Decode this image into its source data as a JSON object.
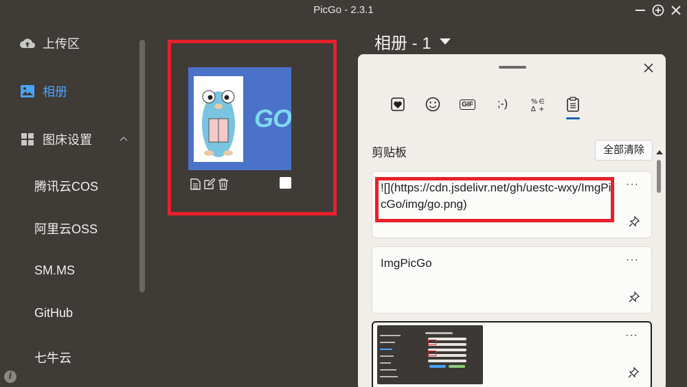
{
  "window": {
    "title": "PicGo - 2.3.1"
  },
  "sidebar": {
    "items": [
      {
        "label": "上传区",
        "icon": "cloud-upload-icon"
      },
      {
        "label": "相册",
        "icon": "image-icon",
        "active": true
      },
      {
        "label": "图床设置",
        "icon": "grid-icon"
      }
    ],
    "sub_items": [
      "腾讯云COS",
      "阿里云OSS",
      "SM.MS",
      "GitHub",
      "七牛云"
    ],
    "info_label": "i"
  },
  "album": {
    "title": "相册 - 1"
  },
  "thumbnail": {
    "logo_text": "GO"
  },
  "clipboard": {
    "tabs": [
      {
        "name": "heart-icon"
      },
      {
        "name": "smiley-icon"
      },
      {
        "name": "gif-icon",
        "label": "GIF"
      },
      {
        "name": "kaomoji-icon",
        "label": ";-)"
      },
      {
        "name": "symbols-icon"
      },
      {
        "name": "clipboard-icon",
        "active": true
      }
    ],
    "section_title": "剪贴板",
    "clear_all": "全部清除",
    "items": [
      {
        "text": "![](https://cdn.jsdelivr.net/gh/uestc-wxy/ImgPicGo/img/go.png)",
        "more": "···"
      },
      {
        "text": "ImgPicGo",
        "more": "···"
      },
      {
        "more": "···"
      }
    ]
  },
  "colors": {
    "accent": "#4aa3ff",
    "highlight": "#e8202a",
    "background": "#3f3b37",
    "panel": "#f1eeea"
  }
}
